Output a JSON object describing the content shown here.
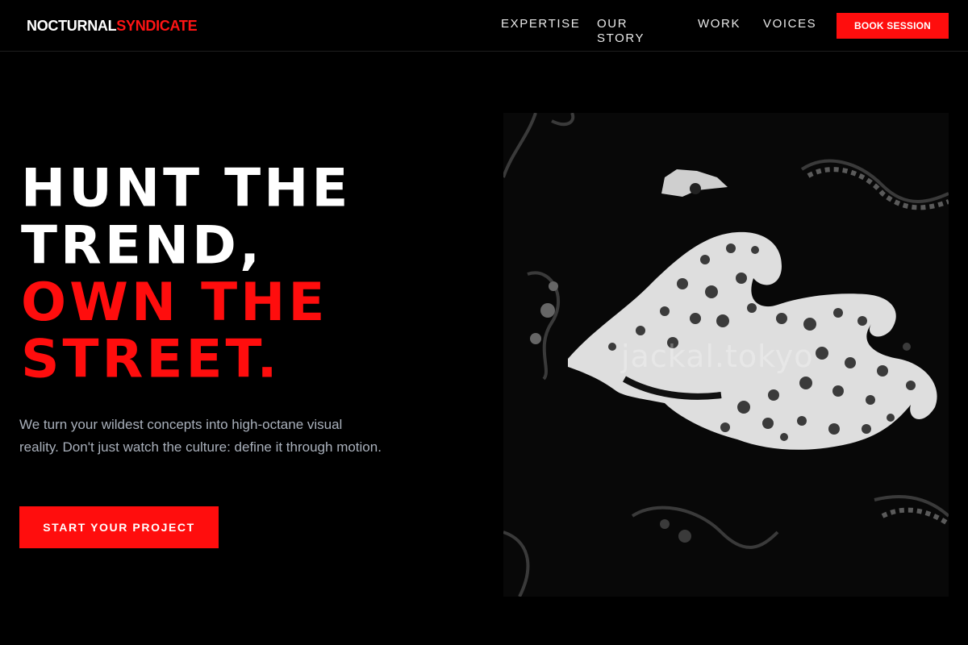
{
  "brand": {
    "part1": "NOCTURNAL",
    "part2": "SYNDICATE"
  },
  "nav": {
    "items": [
      "EXPERTISE",
      "OUR STORY",
      "WORK",
      "VOICES"
    ],
    "cta": "BOOK SESSION"
  },
  "hero": {
    "headline_white": [
      "HUNT THE",
      "TREND,"
    ],
    "headline_red": [
      "OWN THE",
      "STREET."
    ],
    "subtitle": "We turn your wildest concepts into high-octane visual reality. Don't just watch the culture: define it through motion.",
    "cta": "START YOUR PROJECT",
    "image": {
      "watermark": "jackal.tokyo"
    }
  },
  "colors": {
    "accent": "#ff0d0d",
    "background": "#000000",
    "subtitle": "#a9b0bb"
  }
}
